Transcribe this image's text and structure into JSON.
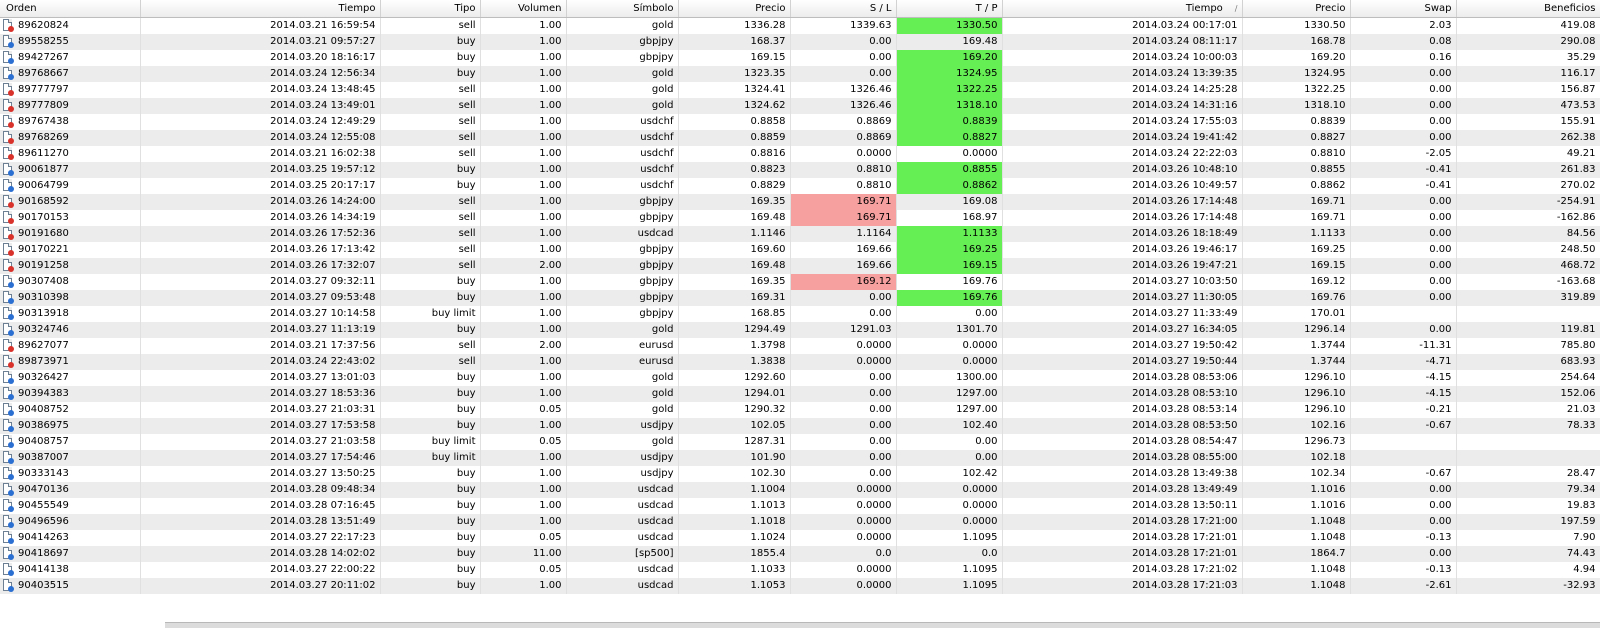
{
  "headers": {
    "order": "Orden",
    "open_time": "Tiempo",
    "type": "Tipo",
    "volume": "Volumen",
    "symbol": "Símbolo",
    "open_price": "Precio",
    "sl": "S / L",
    "tp": "T / P",
    "close_time": "Tiempo",
    "close_price": "Precio",
    "swap": "Swap",
    "profit": "Beneficios"
  },
  "rows": [
    [
      "89620824",
      "2014.03.21 16:59:54",
      "sell",
      "1.00",
      "gold",
      "1336.28",
      "1339.63",
      "1330.50",
      "2014.03.24 00:17:01",
      "1330.50",
      "2.03",
      "419.08",
      "tp"
    ],
    [
      "89558255",
      "2014.03.21 09:57:27",
      "buy",
      "1.00",
      "gbpjpy",
      "168.37",
      "0.00",
      "169.48",
      "2014.03.24 08:11:17",
      "168.78",
      "0.08",
      "290.08",
      ""
    ],
    [
      "89427267",
      "2014.03.20 18:16:17",
      "buy",
      "1.00",
      "gbpjpy",
      "169.15",
      "0.00",
      "169.20",
      "2014.03.24 10:00:03",
      "169.20",
      "0.16",
      "35.29",
      "tp"
    ],
    [
      "89768667",
      "2014.03.24 12:56:34",
      "buy",
      "1.00",
      "gold",
      "1323.35",
      "0.00",
      "1324.95",
      "2014.03.24 13:39:35",
      "1324.95",
      "0.00",
      "116.17",
      "tp"
    ],
    [
      "89777797",
      "2014.03.24 13:48:45",
      "sell",
      "1.00",
      "gold",
      "1324.41",
      "1326.46",
      "1322.25",
      "2014.03.24 14:25:28",
      "1322.25",
      "0.00",
      "156.87",
      "tp"
    ],
    [
      "89777809",
      "2014.03.24 13:49:01",
      "sell",
      "1.00",
      "gold",
      "1324.62",
      "1326.46",
      "1318.10",
      "2014.03.24 14:31:16",
      "1318.10",
      "0.00",
      "473.53",
      "tp"
    ],
    [
      "89767438",
      "2014.03.24 12:49:29",
      "sell",
      "1.00",
      "usdchf",
      "0.8858",
      "0.8869",
      "0.8839",
      "2014.03.24 17:55:03",
      "0.8839",
      "0.00",
      "155.91",
      "tp"
    ],
    [
      "89768269",
      "2014.03.24 12:55:08",
      "sell",
      "1.00",
      "usdchf",
      "0.8859",
      "0.8869",
      "0.8827",
      "2014.03.24 19:41:42",
      "0.8827",
      "0.00",
      "262.38",
      "tp"
    ],
    [
      "89611270",
      "2014.03.21 16:02:38",
      "sell",
      "1.00",
      "usdchf",
      "0.8816",
      "0.0000",
      "0.0000",
      "2014.03.24 22:22:03",
      "0.8810",
      "-2.05",
      "49.21",
      ""
    ],
    [
      "90061877",
      "2014.03.25 19:57:12",
      "buy",
      "1.00",
      "usdchf",
      "0.8823",
      "0.8810",
      "0.8855",
      "2014.03.26 10:48:10",
      "0.8855",
      "-0.41",
      "261.83",
      "tp"
    ],
    [
      "90064799",
      "2014.03.25 20:17:17",
      "buy",
      "1.00",
      "usdchf",
      "0.8829",
      "0.8810",
      "0.8862",
      "2014.03.26 10:49:57",
      "0.8862",
      "-0.41",
      "270.02",
      "tp"
    ],
    [
      "90168592",
      "2014.03.26 14:24:00",
      "sell",
      "1.00",
      "gbpjpy",
      "169.35",
      "169.71",
      "169.08",
      "2014.03.26 17:14:48",
      "169.71",
      "0.00",
      "-254.91",
      "sl"
    ],
    [
      "90170153",
      "2014.03.26 14:34:19",
      "sell",
      "1.00",
      "gbpjpy",
      "169.48",
      "169.71",
      "168.97",
      "2014.03.26 17:14:48",
      "169.71",
      "0.00",
      "-162.86",
      "sl"
    ],
    [
      "90191680",
      "2014.03.26 17:52:36",
      "sell",
      "1.00",
      "usdcad",
      "1.1146",
      "1.1164",
      "1.1133",
      "2014.03.26 18:18:49",
      "1.1133",
      "0.00",
      "84.56",
      "tp"
    ],
    [
      "90170221",
      "2014.03.26 17:13:42",
      "sell",
      "1.00",
      "gbpjpy",
      "169.60",
      "169.66",
      "169.25",
      "2014.03.26 19:46:17",
      "169.25",
      "0.00",
      "248.50",
      "tp"
    ],
    [
      "90191258",
      "2014.03.26 17:32:07",
      "sell",
      "2.00",
      "gbpjpy",
      "169.48",
      "169.66",
      "169.15",
      "2014.03.26 19:47:21",
      "169.15",
      "0.00",
      "468.72",
      "tp"
    ],
    [
      "90307408",
      "2014.03.27 09:32:11",
      "buy",
      "1.00",
      "gbpjpy",
      "169.35",
      "169.12",
      "169.76",
      "2014.03.27 10:03:50",
      "169.12",
      "0.00",
      "-163.68",
      "sl"
    ],
    [
      "90310398",
      "2014.03.27 09:53:48",
      "buy",
      "1.00",
      "gbpjpy",
      "169.31",
      "0.00",
      "169.76",
      "2014.03.27 11:30:05",
      "169.76",
      "0.00",
      "319.89",
      "tp"
    ],
    [
      "90313918",
      "2014.03.27 10:14:58",
      "buy limit",
      "1.00",
      "gbpjpy",
      "168.85",
      "0.00",
      "0.00",
      "2014.03.27 11:33:49",
      "170.01",
      "",
      "",
      ""
    ],
    [
      "90324746",
      "2014.03.27 11:13:19",
      "buy",
      "1.00",
      "gold",
      "1294.49",
      "1291.03",
      "1301.70",
      "2014.03.27 16:34:05",
      "1296.14",
      "0.00",
      "119.81",
      ""
    ],
    [
      "89627077",
      "2014.03.21 17:37:56",
      "sell",
      "2.00",
      "eurusd",
      "1.3798",
      "0.0000",
      "0.0000",
      "2014.03.27 19:50:42",
      "1.3744",
      "-11.31",
      "785.80",
      ""
    ],
    [
      "89873971",
      "2014.03.24 22:43:02",
      "sell",
      "1.00",
      "eurusd",
      "1.3838",
      "0.0000",
      "0.0000",
      "2014.03.27 19:50:44",
      "1.3744",
      "-4.71",
      "683.93",
      ""
    ],
    [
      "90326427",
      "2014.03.27 13:01:03",
      "buy",
      "1.00",
      "gold",
      "1292.60",
      "0.00",
      "1300.00",
      "2014.03.28 08:53:06",
      "1296.10",
      "-4.15",
      "254.64",
      ""
    ],
    [
      "90394383",
      "2014.03.27 18:53:36",
      "buy",
      "1.00",
      "gold",
      "1294.01",
      "0.00",
      "1297.00",
      "2014.03.28 08:53:10",
      "1296.10",
      "-4.15",
      "152.06",
      ""
    ],
    [
      "90408752",
      "2014.03.27 21:03:31",
      "buy",
      "0.05",
      "gold",
      "1290.32",
      "0.00",
      "1297.00",
      "2014.03.28 08:53:14",
      "1296.10",
      "-0.21",
      "21.03",
      ""
    ],
    [
      "90386975",
      "2014.03.27 17:53:58",
      "buy",
      "1.00",
      "usdjpy",
      "102.05",
      "0.00",
      "102.40",
      "2014.03.28 08:53:50",
      "102.16",
      "-0.67",
      "78.33",
      ""
    ],
    [
      "90408757",
      "2014.03.27 21:03:58",
      "buy limit",
      "0.05",
      "gold",
      "1287.31",
      "0.00",
      "0.00",
      "2014.03.28 08:54:47",
      "1296.73",
      "",
      "",
      ""
    ],
    [
      "90387007",
      "2014.03.27 17:54:46",
      "buy limit",
      "1.00",
      "usdjpy",
      "101.90",
      "0.00",
      "0.00",
      "2014.03.28 08:55:00",
      "102.18",
      "",
      "",
      ""
    ],
    [
      "90333143",
      "2014.03.27 13:50:25",
      "buy",
      "1.00",
      "usdjpy",
      "102.30",
      "0.00",
      "102.42",
      "2014.03.28 13:49:38",
      "102.34",
      "-0.67",
      "28.47",
      ""
    ],
    [
      "90470136",
      "2014.03.28 09:48:34",
      "buy",
      "1.00",
      "usdcad",
      "1.1004",
      "0.0000",
      "0.0000",
      "2014.03.28 13:49:49",
      "1.1016",
      "0.00",
      "79.34",
      ""
    ],
    [
      "90455549",
      "2014.03.28 07:16:45",
      "buy",
      "1.00",
      "usdcad",
      "1.1013",
      "0.0000",
      "0.0000",
      "2014.03.28 13:50:11",
      "1.1016",
      "0.00",
      "19.83",
      ""
    ],
    [
      "90496596",
      "2014.03.28 13:51:49",
      "buy",
      "1.00",
      "usdcad",
      "1.1018",
      "0.0000",
      "0.0000",
      "2014.03.28 17:21:00",
      "1.1048",
      "0.00",
      "197.59",
      ""
    ],
    [
      "90414263",
      "2014.03.27 22:17:23",
      "buy",
      "0.05",
      "usdcad",
      "1.1024",
      "0.0000",
      "1.1095",
      "2014.03.28 17:21:01",
      "1.1048",
      "-0.13",
      "7.90",
      ""
    ],
    [
      "90418697",
      "2014.03.28 14:02:02",
      "buy",
      "11.00",
      "[sp500]",
      "1855.4",
      "0.0",
      "0.0",
      "2014.03.28 17:21:01",
      "1864.7",
      "0.00",
      "74.43",
      ""
    ],
    [
      "90414138",
      "2014.03.27 22:00:22",
      "buy",
      "0.05",
      "usdcad",
      "1.1033",
      "0.0000",
      "1.1095",
      "2014.03.28 17:21:02",
      "1.1048",
      "-0.13",
      "4.94",
      ""
    ],
    [
      "90403515",
      "2014.03.27 20:11:02",
      "buy",
      "1.00",
      "usdcad",
      "1.1053",
      "0.0000",
      "1.1095",
      "2014.03.28 17:21:03",
      "1.1048",
      "-2.61",
      "-32.93",
      ""
    ]
  ]
}
